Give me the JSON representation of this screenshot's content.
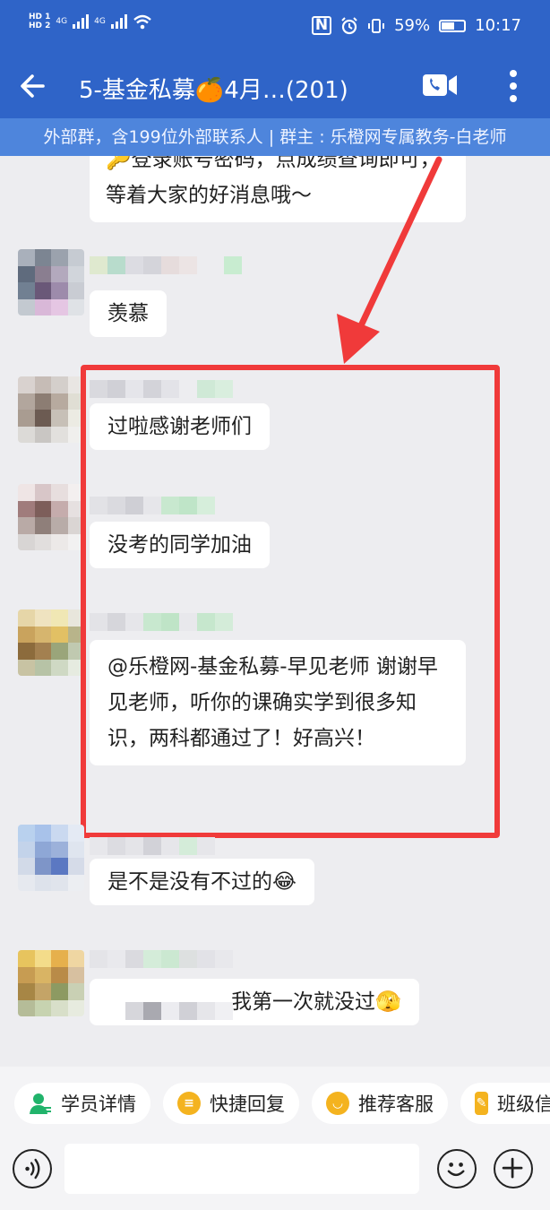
{
  "status_bar": {
    "hd1": "HD 1",
    "hd2": "HD 2",
    "net1": "4G",
    "net2": "4G",
    "battery": "59%",
    "time": "10:17"
  },
  "app_bar": {
    "title": "5-基金私募🍊4月…(201)",
    "icons": [
      "back-arrow-icon",
      "video-call-icon",
      "more-vert-icon"
    ]
  },
  "group_info": "外部群，含199位外部联系人 | 群主 : 乐橙网专属教务-白老师",
  "messages": [
    {
      "text": "🔑登录账号密码，点成绩查询即可，等着大家的好消息哦～"
    },
    {
      "text": "羡慕"
    },
    {
      "text": "过啦感谢老师们"
    },
    {
      "text": "没考的同学加油"
    },
    {
      "text": "@乐橙网-基金私募-早见老师 谢谢早见老师，听你的课确实学到很多知识，两科都通过了！好高兴！"
    },
    {
      "text": "是不是没有不过的😂"
    },
    {
      "text": "我第一次就没过🫣"
    }
  ],
  "quick_actions": [
    {
      "label": "学员详情",
      "icon": "student-detail-icon",
      "color": "#21b36b"
    },
    {
      "label": "快捷回复",
      "icon": "quick-reply-icon",
      "color": "#f4b31f"
    },
    {
      "label": "推荐客服",
      "icon": "recommend-service-icon",
      "color": "#f4b31f"
    },
    {
      "label": "班级信",
      "icon": "class-info-icon",
      "color": "#f4b31f"
    }
  ],
  "input_bar": {
    "placeholder": "",
    "icons": [
      "voice-icon",
      "emoji-icon",
      "plus-icon"
    ]
  },
  "colors": {
    "header": "#2f64c8",
    "subheader": "#4e85dc",
    "chat_bg": "#ededf0",
    "highlight": "#f03a3a"
  }
}
